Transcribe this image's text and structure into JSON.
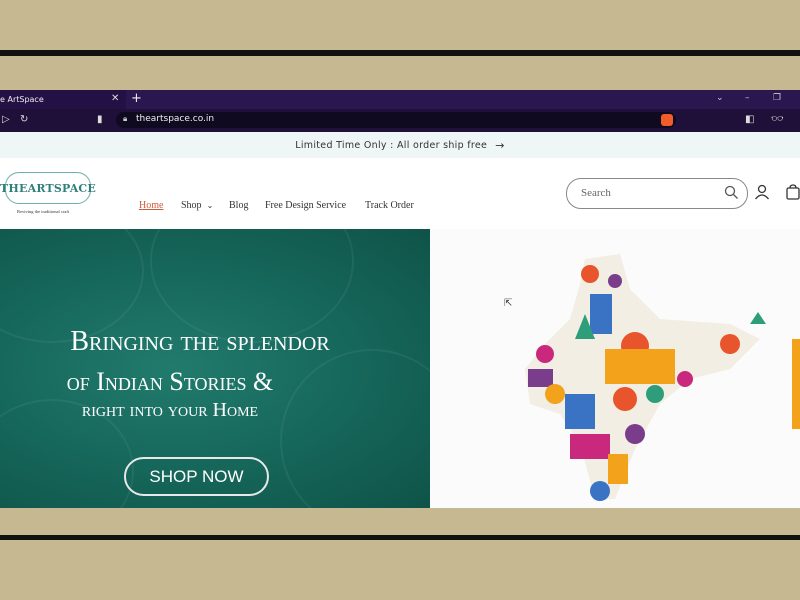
{
  "browser": {
    "tab_title": "e ArtSpace",
    "tab_close": "✕",
    "new_tab": "+",
    "url": "theartspace.co.in"
  },
  "announcement": {
    "text": "Limited Time Only : All order ship free",
    "arrow": "→"
  },
  "header": {
    "logo_text": "THEARTSPACE",
    "logo_tagline": "Reviving the traditional craft",
    "nav": [
      {
        "label": "Home",
        "active": true
      },
      {
        "label": "Shop",
        "has_dropdown": true
      },
      {
        "label": "Blog"
      },
      {
        "label": "Free Design Service"
      },
      {
        "label": "Track Order"
      }
    ],
    "search_placeholder": "Search",
    "icons": [
      "search-icon",
      "user-icon",
      "cart-icon"
    ]
  },
  "hero": {
    "line1": "Bringing the splendor",
    "line2": "of Indian Stories &",
    "line3": "right into your Home",
    "cta": "SHOP NOW",
    "bg_color": "#17695d",
    "map_colors": [
      "#e8542c",
      "#f2a21b",
      "#7a3d8c",
      "#2e9e7a",
      "#3a72c4",
      "#c9287d"
    ]
  },
  "frame": {
    "border_color": "#c6b890"
  }
}
